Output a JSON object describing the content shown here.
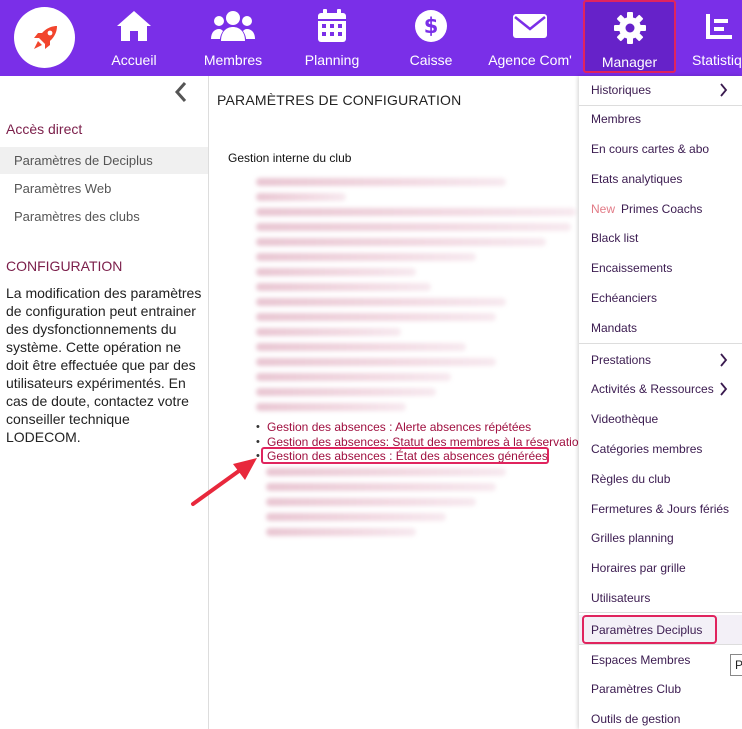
{
  "nav": {
    "items": [
      {
        "label": "Accueil",
        "icon": "home-icon"
      },
      {
        "label": "Membres",
        "icon": "users-icon"
      },
      {
        "label": "Planning",
        "icon": "calendar-icon"
      },
      {
        "label": "Caisse",
        "icon": "dollar-icon"
      },
      {
        "label": "Agence Com'",
        "icon": "envelope-icon"
      },
      {
        "label": "Manager",
        "icon": "gear-icon"
      },
      {
        "label": "Statistiq",
        "icon": "stats-icon"
      }
    ],
    "active": "Manager",
    "color": "#7a2fe8"
  },
  "sidebar": {
    "direct_access_title": "Accès direct",
    "links": [
      "Paramètres de Deciplus",
      "Paramètres Web",
      "Paramètres des clubs"
    ],
    "active_link": "Paramètres de Deciplus",
    "config_title": "CONFIGURATION",
    "config_text": "La modification des paramètres de configuration peut entrainer des dysfonctionnements du système. Cette opération ne doit être effectuée que par des utilisateurs expérimentés. En cas de doute, contactez votre conseiller technique LODECOM."
  },
  "main": {
    "title": "PARAMÈTRES DE CONFIGURATION",
    "section_title": "Gestion interne du club",
    "links": [
      "Gestion des absences : Alerte absences répétées",
      "Gestion des absences: Statut des membres à la réservation",
      "Gestion des absences : État des absences générées"
    ],
    "highlighted_link": "Gestion des absences : État des absences générées"
  },
  "dropdown": {
    "items": [
      {
        "label": "Historiques",
        "chevron": true
      },
      {
        "label": "Membres"
      },
      {
        "label": "En cours cartes & abo"
      },
      {
        "label": "Etats analytiques"
      },
      {
        "label": "Primes Coachs",
        "badge": "New"
      },
      {
        "label": "Black list"
      },
      {
        "label": "Encaissements"
      },
      {
        "label": "Echéanciers"
      },
      {
        "label": "Mandats"
      },
      {
        "label": "Prestations",
        "chevron": true
      },
      {
        "label": "Activités & Ressources",
        "chevron": true
      },
      {
        "label": "Videothèque"
      },
      {
        "label": "Catégories membres"
      },
      {
        "label": "Règles du club"
      },
      {
        "label": "Fermetures & Jours fériés"
      },
      {
        "label": "Grilles planning"
      },
      {
        "label": "Horaires par grille"
      },
      {
        "label": "Utilisateurs"
      },
      {
        "label": "Paramètres Deciplus"
      },
      {
        "label": "Espaces Membres"
      },
      {
        "label": "Paramètres Club"
      },
      {
        "label": "Outils de gestion"
      }
    ],
    "highlighted": "Paramètres Deciplus"
  },
  "tooltip_fragment": "P",
  "colors": {
    "accent": "#7a2fe8",
    "highlight_border": "#e0245e",
    "link": "#a01040",
    "arrow": "#e8283c"
  }
}
